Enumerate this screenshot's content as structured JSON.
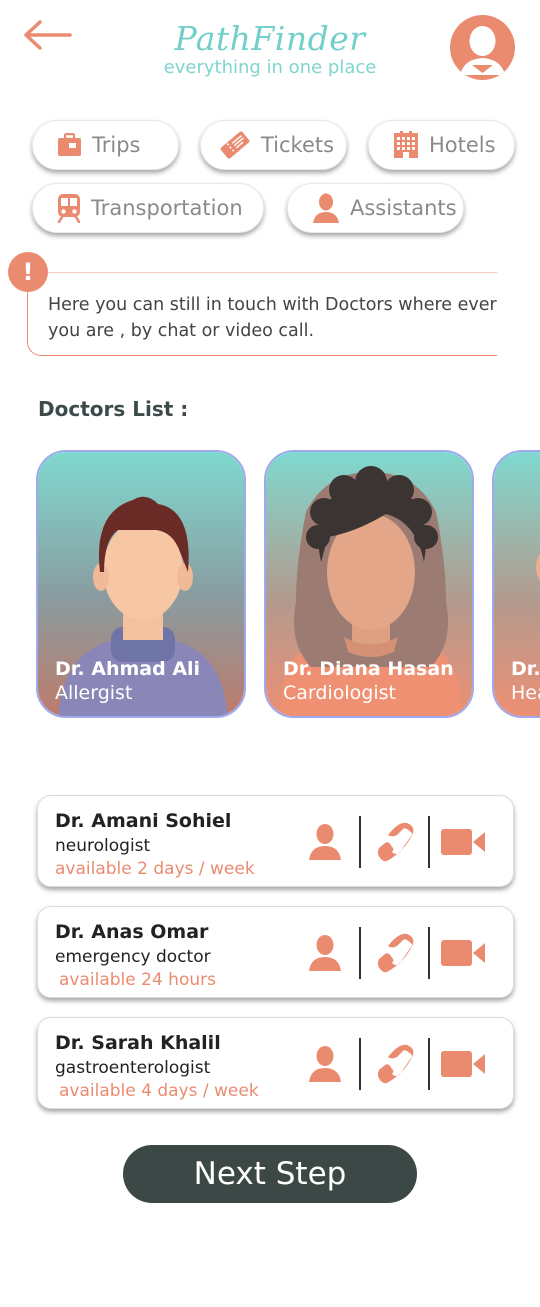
{
  "header": {
    "brand_title": "PathFinder",
    "brand_subtitle": "everything in one place",
    "back_icon": "back-arrow-icon",
    "avatar_icon": "user-avatar-icon"
  },
  "categories": [
    {
      "label": "Trips",
      "icon": "suitcase-icon"
    },
    {
      "label": "Tickets",
      "icon": "ticket-icon"
    },
    {
      "label": "Hotels",
      "icon": "hotel-building-icon"
    },
    {
      "label": "Transportation",
      "icon": "train-icon"
    },
    {
      "label": "Assistants",
      "icon": "person-icon"
    }
  ],
  "info": {
    "mark": "!",
    "text": "Here you can still in touch with Doctors where ever you are , by chat or video call."
  },
  "doctors_title": "Doctors List :",
  "featured_doctors": [
    {
      "name": "Dr. Ahmad Ali",
      "specialty": "Allergist"
    },
    {
      "name": "Dr. Diana Hasan",
      "specialty": "Cardiologist"
    },
    {
      "name": "Dr.",
      "specialty": "Hea"
    }
  ],
  "doctor_rows": [
    {
      "name": "Dr. Amani Sohiel",
      "specialty": "neurologist",
      "availability": "available 2 days / week"
    },
    {
      "name": "Dr. Anas Omar",
      "specialty": "emergency doctor",
      "availability": "available 24 hours"
    },
    {
      "name": "Dr. Sarah Khalil",
      "specialty": "gastroenterologist",
      "availability": "available 4 days / week"
    }
  ],
  "next_button": "Next Step",
  "colors": {
    "accent": "#ea8b70",
    "brand": "#73cfc9",
    "dark_button": "#3b4845"
  }
}
